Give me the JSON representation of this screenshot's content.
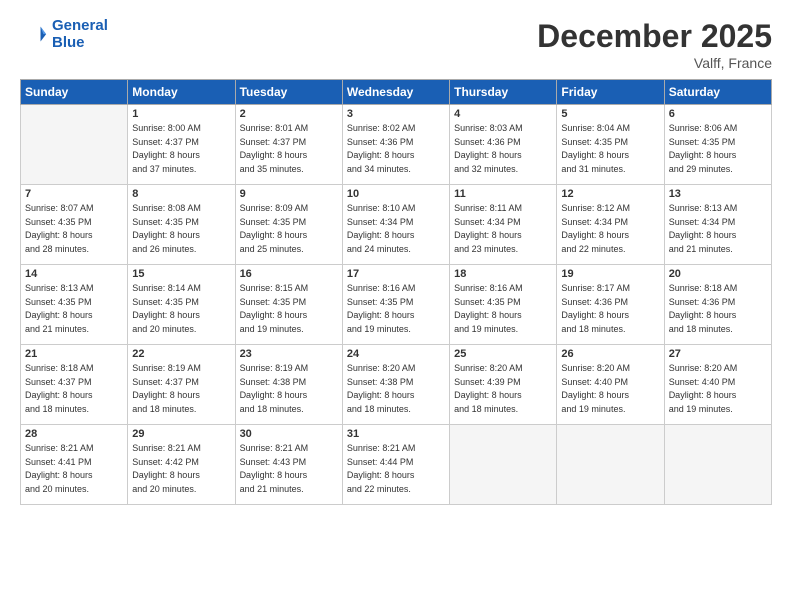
{
  "header": {
    "logo_line1": "General",
    "logo_line2": "Blue",
    "title": "December 2025",
    "location": "Valff, France"
  },
  "columns": [
    "Sunday",
    "Monday",
    "Tuesday",
    "Wednesday",
    "Thursday",
    "Friday",
    "Saturday"
  ],
  "weeks": [
    [
      {
        "day": "",
        "info": ""
      },
      {
        "day": "1",
        "info": "Sunrise: 8:00 AM\nSunset: 4:37 PM\nDaylight: 8 hours\nand 37 minutes."
      },
      {
        "day": "2",
        "info": "Sunrise: 8:01 AM\nSunset: 4:37 PM\nDaylight: 8 hours\nand 35 minutes."
      },
      {
        "day": "3",
        "info": "Sunrise: 8:02 AM\nSunset: 4:36 PM\nDaylight: 8 hours\nand 34 minutes."
      },
      {
        "day": "4",
        "info": "Sunrise: 8:03 AM\nSunset: 4:36 PM\nDaylight: 8 hours\nand 32 minutes."
      },
      {
        "day": "5",
        "info": "Sunrise: 8:04 AM\nSunset: 4:35 PM\nDaylight: 8 hours\nand 31 minutes."
      },
      {
        "day": "6",
        "info": "Sunrise: 8:06 AM\nSunset: 4:35 PM\nDaylight: 8 hours\nand 29 minutes."
      }
    ],
    [
      {
        "day": "7",
        "info": "Sunrise: 8:07 AM\nSunset: 4:35 PM\nDaylight: 8 hours\nand 28 minutes."
      },
      {
        "day": "8",
        "info": "Sunrise: 8:08 AM\nSunset: 4:35 PM\nDaylight: 8 hours\nand 26 minutes."
      },
      {
        "day": "9",
        "info": "Sunrise: 8:09 AM\nSunset: 4:35 PM\nDaylight: 8 hours\nand 25 minutes."
      },
      {
        "day": "10",
        "info": "Sunrise: 8:10 AM\nSunset: 4:34 PM\nDaylight: 8 hours\nand 24 minutes."
      },
      {
        "day": "11",
        "info": "Sunrise: 8:11 AM\nSunset: 4:34 PM\nDaylight: 8 hours\nand 23 minutes."
      },
      {
        "day": "12",
        "info": "Sunrise: 8:12 AM\nSunset: 4:34 PM\nDaylight: 8 hours\nand 22 minutes."
      },
      {
        "day": "13",
        "info": "Sunrise: 8:13 AM\nSunset: 4:34 PM\nDaylight: 8 hours\nand 21 minutes."
      }
    ],
    [
      {
        "day": "14",
        "info": "Sunrise: 8:13 AM\nSunset: 4:35 PM\nDaylight: 8 hours\nand 21 minutes."
      },
      {
        "day": "15",
        "info": "Sunrise: 8:14 AM\nSunset: 4:35 PM\nDaylight: 8 hours\nand 20 minutes."
      },
      {
        "day": "16",
        "info": "Sunrise: 8:15 AM\nSunset: 4:35 PM\nDaylight: 8 hours\nand 19 minutes."
      },
      {
        "day": "17",
        "info": "Sunrise: 8:16 AM\nSunset: 4:35 PM\nDaylight: 8 hours\nand 19 minutes."
      },
      {
        "day": "18",
        "info": "Sunrise: 8:16 AM\nSunset: 4:35 PM\nDaylight: 8 hours\nand 19 minutes."
      },
      {
        "day": "19",
        "info": "Sunrise: 8:17 AM\nSunset: 4:36 PM\nDaylight: 8 hours\nand 18 minutes."
      },
      {
        "day": "20",
        "info": "Sunrise: 8:18 AM\nSunset: 4:36 PM\nDaylight: 8 hours\nand 18 minutes."
      }
    ],
    [
      {
        "day": "21",
        "info": "Sunrise: 8:18 AM\nSunset: 4:37 PM\nDaylight: 8 hours\nand 18 minutes."
      },
      {
        "day": "22",
        "info": "Sunrise: 8:19 AM\nSunset: 4:37 PM\nDaylight: 8 hours\nand 18 minutes."
      },
      {
        "day": "23",
        "info": "Sunrise: 8:19 AM\nSunset: 4:38 PM\nDaylight: 8 hours\nand 18 minutes."
      },
      {
        "day": "24",
        "info": "Sunrise: 8:20 AM\nSunset: 4:38 PM\nDaylight: 8 hours\nand 18 minutes."
      },
      {
        "day": "25",
        "info": "Sunrise: 8:20 AM\nSunset: 4:39 PM\nDaylight: 8 hours\nand 18 minutes."
      },
      {
        "day": "26",
        "info": "Sunrise: 8:20 AM\nSunset: 4:40 PM\nDaylight: 8 hours\nand 19 minutes."
      },
      {
        "day": "27",
        "info": "Sunrise: 8:20 AM\nSunset: 4:40 PM\nDaylight: 8 hours\nand 19 minutes."
      }
    ],
    [
      {
        "day": "28",
        "info": "Sunrise: 8:21 AM\nSunset: 4:41 PM\nDaylight: 8 hours\nand 20 minutes."
      },
      {
        "day": "29",
        "info": "Sunrise: 8:21 AM\nSunset: 4:42 PM\nDaylight: 8 hours\nand 20 minutes."
      },
      {
        "day": "30",
        "info": "Sunrise: 8:21 AM\nSunset: 4:43 PM\nDaylight: 8 hours\nand 21 minutes."
      },
      {
        "day": "31",
        "info": "Sunrise: 8:21 AM\nSunset: 4:44 PM\nDaylight: 8 hours\nand 22 minutes."
      },
      {
        "day": "",
        "info": ""
      },
      {
        "day": "",
        "info": ""
      },
      {
        "day": "",
        "info": ""
      }
    ]
  ]
}
